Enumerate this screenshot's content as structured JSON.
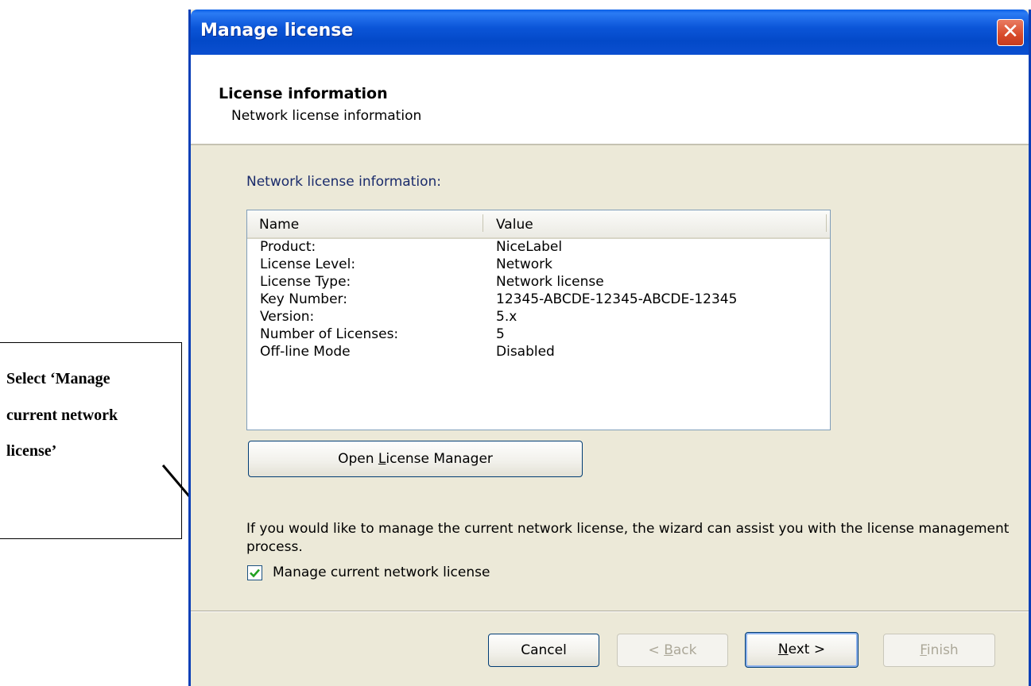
{
  "annotation": {
    "lines": [
      "Select ‘Manage",
      "current network",
      "license’"
    ]
  },
  "window": {
    "title": "Manage license",
    "close_glyph": "✕"
  },
  "header": {
    "title": "License information",
    "subtitle": "Network license information"
  },
  "main": {
    "section_label": "Network license information:",
    "columns": [
      "Name",
      "Value"
    ],
    "rows": [
      {
        "name": "Product:",
        "value": "NiceLabel"
      },
      {
        "name": "License Level:",
        "value": "Network"
      },
      {
        "name": "License Type:",
        "value": "Network license"
      },
      {
        "name": "Key Number:",
        "value": "12345-ABCDE-12345-ABCDE-12345"
      },
      {
        "name": "Version:",
        "value": "5.x"
      },
      {
        "name": "Number of Licenses:",
        "value": "5"
      },
      {
        "name": "Off-line Mode",
        "value": "Disabled"
      }
    ],
    "open_button": {
      "prefix": "Open ",
      "hotkey": "L",
      "suffix": "icense Manager"
    },
    "info_text": "If you would like to manage the current network license, the wizard can assist you with the license management process.",
    "checkbox": {
      "label": "Manage current network license",
      "checked": true
    }
  },
  "footer": {
    "cancel": "Cancel",
    "back": {
      "prefix": "< ",
      "hotkey": "B",
      "suffix": "ack"
    },
    "next": {
      "prefix": "",
      "hotkey": "N",
      "suffix": "ext >"
    },
    "finish": {
      "prefix": "",
      "hotkey": "F",
      "suffix": "inish"
    }
  },
  "colors": {
    "titlebar": "#0b55d8",
    "dialog_bg": "#ece9d8",
    "check": "#21a121",
    "disabled_text": "#aca899"
  }
}
